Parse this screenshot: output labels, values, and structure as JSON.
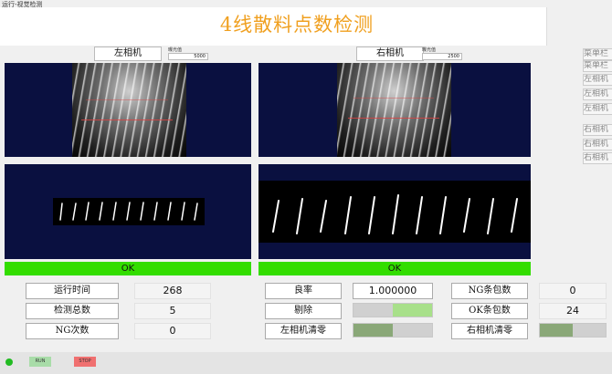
{
  "window": {
    "title": "运行-视觉检测"
  },
  "header": {
    "title": "4线散料点数检测"
  },
  "cameras": {
    "left": {
      "label": "左相机",
      "param_label": "曝光值",
      "param_value": "5000"
    },
    "right": {
      "label": "右相机",
      "param_label": "曝光值",
      "param_value": "2500"
    }
  },
  "results": {
    "left": "OK",
    "right": "OK"
  },
  "side_menu": [
    "菜单栏",
    "菜单栏",
    "左相机",
    "左相机",
    "左相机",
    "右相机",
    "右相机",
    "右相机"
  ],
  "stats": {
    "run_time": {
      "label": "运行时间",
      "value": "268"
    },
    "total": {
      "label": "检测总数",
      "value": "5"
    },
    "ng_count": {
      "label": "NG次数",
      "value": "0"
    },
    "yield": {
      "label": "良率",
      "value": "1.000000"
    },
    "reject": {
      "label": "剔除"
    },
    "left_clear": {
      "label": "左相机清零"
    },
    "ng_bags": {
      "label": "NG条包数",
      "value": "0"
    },
    "ok_bags": {
      "label": "OK条包数",
      "value": "24"
    },
    "right_clear": {
      "label": "右相机清零"
    }
  },
  "indicators": {
    "reject_level": 0.5,
    "left_clear_level": 0.5,
    "right_clear_level": 0.5,
    "reject_color": "#a8e08a",
    "clear_color": "#8aa878"
  },
  "footer": {
    "btn1": "RUN",
    "btn2": "STOP",
    "status_color": "#22bb22"
  },
  "colors": {
    "title": "#f0a020",
    "ok": "#33dd00",
    "view_bg": "#0a1040"
  }
}
